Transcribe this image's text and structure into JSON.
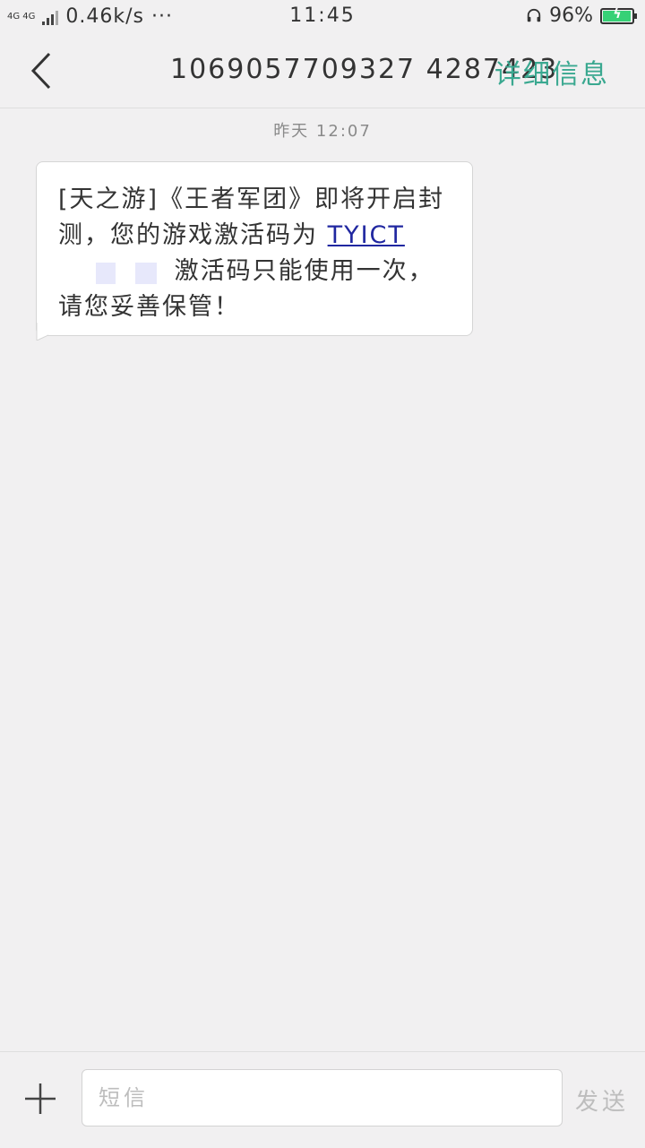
{
  "status": {
    "net_type_top": "4G 4G",
    "speed": "0.46k/s ···",
    "time": "11:45",
    "battery_percent": "96%",
    "battery_level": 0.96,
    "icons": [
      "signal-icon",
      "headset-icon",
      "battery-icon"
    ]
  },
  "header": {
    "title": "1069057709327 4287423",
    "details_label": "详细信息",
    "accent_color": "#3aa890"
  },
  "conversation": {
    "timestamp": "昨天 12:07",
    "message": {
      "text_part1": "[天之游]《王者军团》即将开启封测，您的游戏激活码为",
      "code_visible": "TYICT",
      "text_part2": "，激活码只能使用一次，请您妥善保管！"
    }
  },
  "composer": {
    "input_placeholder": "短信",
    "send_label": "发送"
  }
}
